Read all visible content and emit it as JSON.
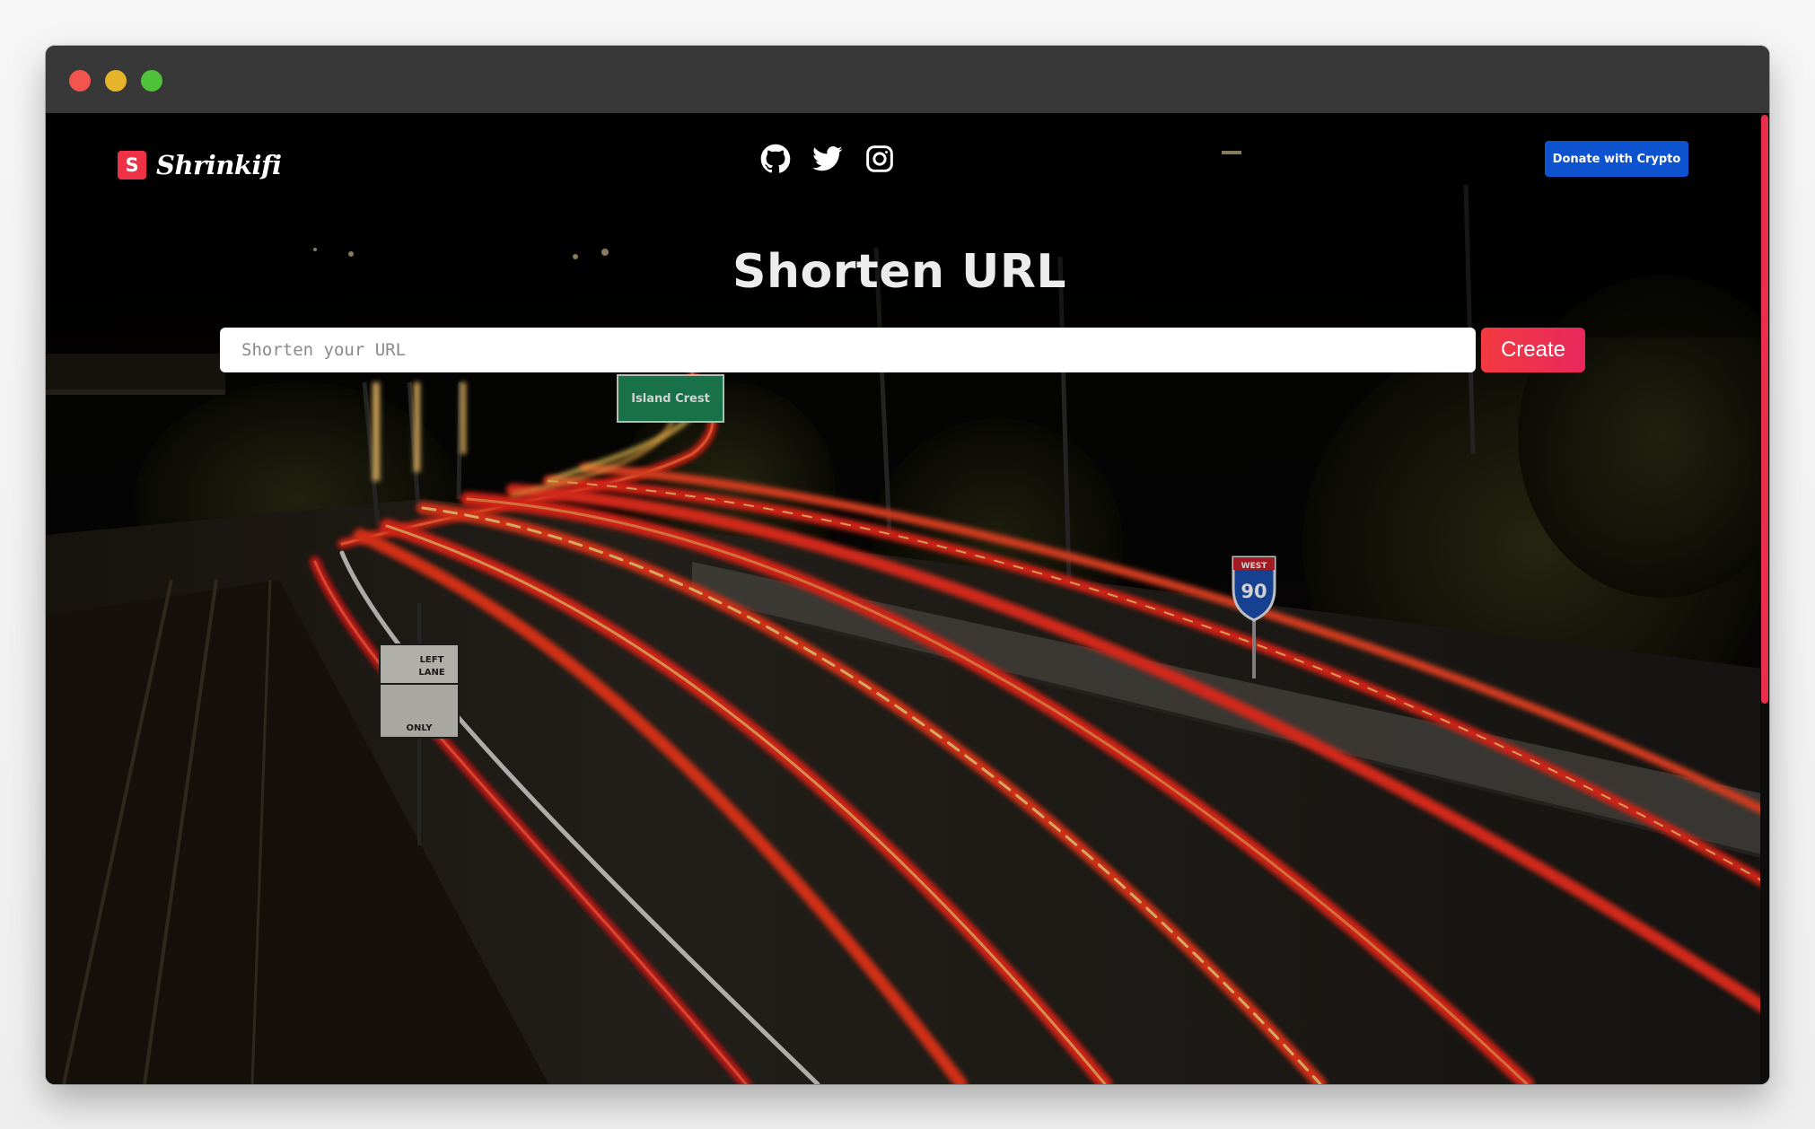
{
  "window": {
    "controls": [
      "close",
      "minimize",
      "maximize"
    ]
  },
  "nav": {
    "brand_badge": "S",
    "brand_name": "Shrinkifi",
    "social_icons": [
      "github-icon",
      "twitter-icon",
      "instagram-icon"
    ],
    "donate_label": "Donate with Crypto"
  },
  "hero": {
    "title": "Shorten URL",
    "input_placeholder": "Shorten your URL",
    "input_value": "",
    "create_label": "Create"
  },
  "background": {
    "description_icon": "night-highway-light-trails",
    "road_signs": {
      "green_sign": "Island Crest",
      "interstate_direction": "WEST",
      "interstate_number": "90",
      "lane_sign_top": "LEFT LANE",
      "lane_sign_bottom": "ONLY"
    }
  },
  "colors": {
    "brand": "#ef3148",
    "donate": "#0d52cf",
    "create": "#f23a40",
    "scroll_thumb": "#e8304a"
  }
}
